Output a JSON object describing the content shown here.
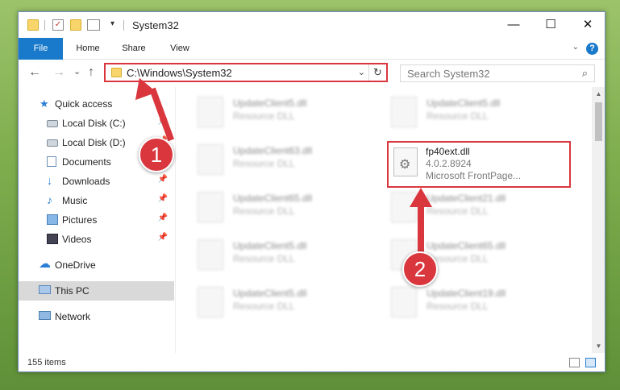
{
  "window": {
    "title": "System32",
    "controls": {
      "minimize": "—",
      "maximize": "☐",
      "close": "✕"
    }
  },
  "ribbon": {
    "tabs": [
      "File",
      "Home",
      "Share",
      "View"
    ],
    "help": "?"
  },
  "nav": {
    "back": "←",
    "forward": "→",
    "recent": "⌄",
    "up": "↑",
    "address": "C:\\Windows\\System32",
    "dropdown": "⌄",
    "refresh": "↻",
    "search_placeholder": "Search System32"
  },
  "sidebar": {
    "items": [
      {
        "label": "Quick access",
        "icon": "star-icon"
      },
      {
        "label": "Local Disk (C:)",
        "icon": "disk-icon",
        "pinned": true
      },
      {
        "label": "Local Disk (D:)",
        "icon": "disk-icon",
        "pinned": true
      },
      {
        "label": "Documents",
        "icon": "documents-icon",
        "pinned": true
      },
      {
        "label": "Downloads",
        "icon": "download-icon",
        "pinned": true
      },
      {
        "label": "Music",
        "icon": "music-icon",
        "pinned": true
      },
      {
        "label": "Pictures",
        "icon": "pictures-icon",
        "pinned": true
      },
      {
        "label": "Videos",
        "icon": "videos-icon",
        "pinned": true
      },
      {
        "label": "OneDrive",
        "icon": "cloud-icon"
      },
      {
        "label": "This PC",
        "icon": "pc-icon",
        "selected": true
      },
      {
        "label": "Network",
        "icon": "network-icon"
      }
    ]
  },
  "files": {
    "left_column": [
      {
        "name": "UpdateClient5.dll",
        "desc": "Resource DLL"
      },
      {
        "name": "UpdateClient63.dll",
        "desc": "Resource DLL"
      },
      {
        "name": "UpdateClient65.dll",
        "desc": "Resource DLL"
      },
      {
        "name": "UpdateClient5.dll",
        "desc": "Resource DLL"
      },
      {
        "name": "UpdateClient5.dll",
        "desc": "Resource DLL"
      }
    ],
    "right_column": [
      {
        "name": "UpdateClient5.dll",
        "desc": "Resource DLL"
      },
      {
        "name": "UpdateClient21.dll",
        "desc": "Resource DLL"
      },
      {
        "name": "UpdateClient65.dll",
        "desc": "Resource DLL"
      },
      {
        "name": "UpdateClient19.dll",
        "desc": "Resource DLL"
      }
    ],
    "highlighted": {
      "name": "fp40ext.dll",
      "version": "4.0.2.8924",
      "desc": "Microsoft FrontPage..."
    }
  },
  "status": {
    "count": "155 items"
  },
  "annotations": {
    "step1": "1",
    "step2": "2",
    "color": "#d9363e"
  }
}
